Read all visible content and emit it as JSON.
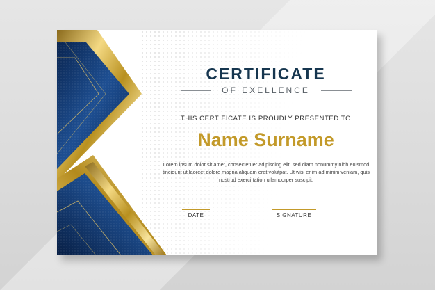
{
  "certificate": {
    "title": "CERTIFICATE",
    "subtitle": "OF EXELLENCE",
    "presented_text": "THIS CERTIFICATE IS PROUDLY PRESENTED TO",
    "recipient_name": "Name Surname",
    "body_text": "Lorem ipsum dolor sit amet, consectetuer adipiscing elit, sed diam nonummy nibh euismod tincidunt ut laoreet dolore magna aliquam erat volutpat. Ut wisi enim ad minim veniam, quis nostrud exerci tation ullamcorper suscipit.",
    "date_label": "DATE",
    "signature_label": "SIGNATURE"
  },
  "colors": {
    "navy": "#16364f",
    "blue_dark": "#0b2a56",
    "blue_light": "#1f5aa3",
    "gold": "#c39a2a",
    "gold_light": "#f2d57a"
  }
}
